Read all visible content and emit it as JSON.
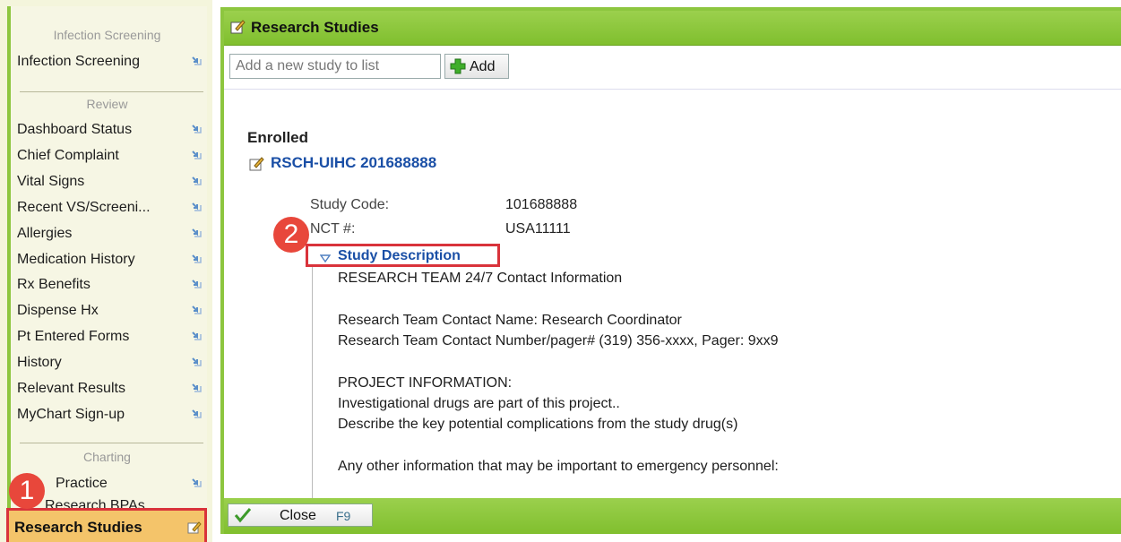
{
  "sidebar": {
    "sections": [
      {
        "title": "Infection Screening",
        "items": [
          "Infection Screening"
        ]
      },
      {
        "title": "Review",
        "items": [
          "Dashboard Status",
          "Chief Complaint",
          "Vital Signs",
          "Recent VS/Screeni...",
          "Allergies",
          "Medication History",
          "Rx Benefits",
          "Dispense Hx",
          "Pt Entered Forms",
          "History",
          "Relevant Results",
          "MyChart Sign-up"
        ]
      },
      {
        "title": "Charting",
        "items": [
          "Practice",
          "Research BPAs"
        ]
      }
    ],
    "active_item": "Research Studies",
    "badge1": "1"
  },
  "panel": {
    "title": "Research Studies",
    "add_placeholder": "Add a new study to list",
    "add_label": "Add",
    "enrolled_heading": "Enrolled",
    "study_name": "RSCH-UIHC 201688888",
    "study_code_label": "Study Code:",
    "study_code_value": "101688888",
    "nct_label": "NCT #:",
    "nct_value": "USA11111",
    "badge2": "2",
    "desc_toggle_label": "Study Description",
    "description_lines": [
      "RESEARCH TEAM 24/7 Contact Information",
      "",
      "Research Team Contact Name: Research Coordinator",
      "Research Team Contact Number/pager# (319) 356-xxxx, Pager: 9xx9",
      "",
      "PROJECT INFORMATION:",
      "Investigational drugs are part of this project..",
      "Describe the key potential complications from the study drug(s)",
      "",
      "Any other information that may be important to emergency personnel:"
    ],
    "close_label": "Close",
    "close_key": "F9"
  },
  "colors": {
    "accent_green": "#8dc63f",
    "highlight_red": "#d9333b",
    "link_blue": "#1a4fa6",
    "active_bg": "#f4c46a"
  }
}
